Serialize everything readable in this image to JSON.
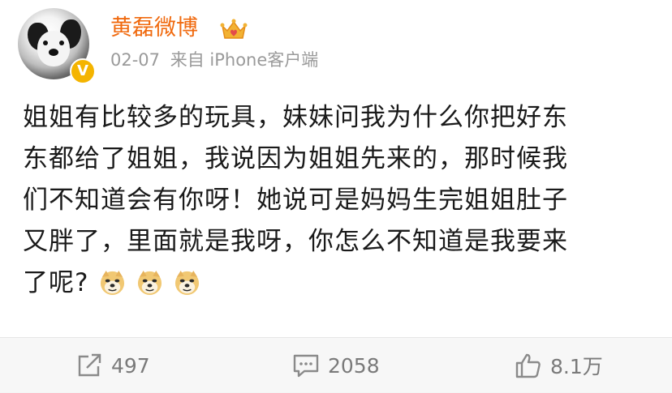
{
  "post": {
    "author": {
      "name": "黄磊微博",
      "avatar_icon": "puppy-avatar",
      "verified_icon": "verified-v-icon",
      "vip_icon": "crown-vip-icon"
    },
    "meta": {
      "date": "02-07",
      "source": "来自 iPhone客户端"
    },
    "content": {
      "lines": [
        "姐姐有比较多的玩具，妹妹问我为什么你把好东",
        "东都给了姐姐，我说因为姐姐先来的，那时候我",
        "们不知道会有你呀！她说可是妈妈生完姐姐肚子",
        "又胖了，里面就是我呀，你怎么不知道是我要来",
        "了呢?"
      ],
      "emojis": [
        "doge-emoji",
        "doge-emoji",
        "doge-emoji"
      ]
    }
  },
  "toolbar": {
    "repost": {
      "icon": "repost-icon",
      "count": "497"
    },
    "comment": {
      "icon": "comment-icon",
      "count": "2058"
    },
    "like": {
      "icon": "thumbs-up-icon",
      "count": "8.1万"
    }
  },
  "colors": {
    "username": "#f06a0f",
    "badge": "#f4b400",
    "meta": "#9a9a9a",
    "action": "#7a7a7a"
  }
}
